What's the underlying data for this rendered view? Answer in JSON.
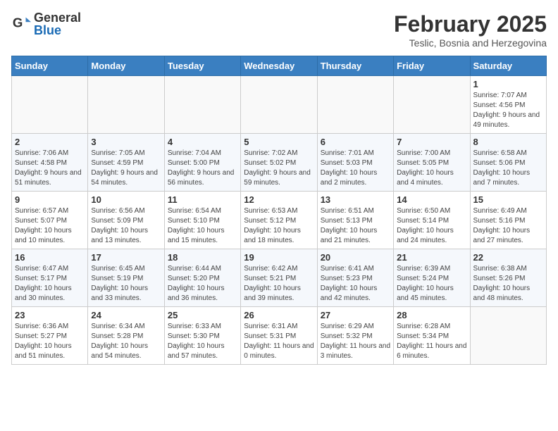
{
  "header": {
    "logo_general": "General",
    "logo_blue": "Blue",
    "month_year": "February 2025",
    "location": "Teslic, Bosnia and Herzegovina"
  },
  "weekdays": [
    "Sunday",
    "Monday",
    "Tuesday",
    "Wednesday",
    "Thursday",
    "Friday",
    "Saturday"
  ],
  "weeks": [
    [
      {
        "day": "",
        "info": ""
      },
      {
        "day": "",
        "info": ""
      },
      {
        "day": "",
        "info": ""
      },
      {
        "day": "",
        "info": ""
      },
      {
        "day": "",
        "info": ""
      },
      {
        "day": "",
        "info": ""
      },
      {
        "day": "1",
        "info": "Sunrise: 7:07 AM\nSunset: 4:56 PM\nDaylight: 9 hours and 49 minutes."
      }
    ],
    [
      {
        "day": "2",
        "info": "Sunrise: 7:06 AM\nSunset: 4:58 PM\nDaylight: 9 hours and 51 minutes."
      },
      {
        "day": "3",
        "info": "Sunrise: 7:05 AM\nSunset: 4:59 PM\nDaylight: 9 hours and 54 minutes."
      },
      {
        "day": "4",
        "info": "Sunrise: 7:04 AM\nSunset: 5:00 PM\nDaylight: 9 hours and 56 minutes."
      },
      {
        "day": "5",
        "info": "Sunrise: 7:02 AM\nSunset: 5:02 PM\nDaylight: 9 hours and 59 minutes."
      },
      {
        "day": "6",
        "info": "Sunrise: 7:01 AM\nSunset: 5:03 PM\nDaylight: 10 hours and 2 minutes."
      },
      {
        "day": "7",
        "info": "Sunrise: 7:00 AM\nSunset: 5:05 PM\nDaylight: 10 hours and 4 minutes."
      },
      {
        "day": "8",
        "info": "Sunrise: 6:58 AM\nSunset: 5:06 PM\nDaylight: 10 hours and 7 minutes."
      }
    ],
    [
      {
        "day": "9",
        "info": "Sunrise: 6:57 AM\nSunset: 5:07 PM\nDaylight: 10 hours and 10 minutes."
      },
      {
        "day": "10",
        "info": "Sunrise: 6:56 AM\nSunset: 5:09 PM\nDaylight: 10 hours and 13 minutes."
      },
      {
        "day": "11",
        "info": "Sunrise: 6:54 AM\nSunset: 5:10 PM\nDaylight: 10 hours and 15 minutes."
      },
      {
        "day": "12",
        "info": "Sunrise: 6:53 AM\nSunset: 5:12 PM\nDaylight: 10 hours and 18 minutes."
      },
      {
        "day": "13",
        "info": "Sunrise: 6:51 AM\nSunset: 5:13 PM\nDaylight: 10 hours and 21 minutes."
      },
      {
        "day": "14",
        "info": "Sunrise: 6:50 AM\nSunset: 5:14 PM\nDaylight: 10 hours and 24 minutes."
      },
      {
        "day": "15",
        "info": "Sunrise: 6:49 AM\nSunset: 5:16 PM\nDaylight: 10 hours and 27 minutes."
      }
    ],
    [
      {
        "day": "16",
        "info": "Sunrise: 6:47 AM\nSunset: 5:17 PM\nDaylight: 10 hours and 30 minutes."
      },
      {
        "day": "17",
        "info": "Sunrise: 6:45 AM\nSunset: 5:19 PM\nDaylight: 10 hours and 33 minutes."
      },
      {
        "day": "18",
        "info": "Sunrise: 6:44 AM\nSunset: 5:20 PM\nDaylight: 10 hours and 36 minutes."
      },
      {
        "day": "19",
        "info": "Sunrise: 6:42 AM\nSunset: 5:21 PM\nDaylight: 10 hours and 39 minutes."
      },
      {
        "day": "20",
        "info": "Sunrise: 6:41 AM\nSunset: 5:23 PM\nDaylight: 10 hours and 42 minutes."
      },
      {
        "day": "21",
        "info": "Sunrise: 6:39 AM\nSunset: 5:24 PM\nDaylight: 10 hours and 45 minutes."
      },
      {
        "day": "22",
        "info": "Sunrise: 6:38 AM\nSunset: 5:26 PM\nDaylight: 10 hours and 48 minutes."
      }
    ],
    [
      {
        "day": "23",
        "info": "Sunrise: 6:36 AM\nSunset: 5:27 PM\nDaylight: 10 hours and 51 minutes."
      },
      {
        "day": "24",
        "info": "Sunrise: 6:34 AM\nSunset: 5:28 PM\nDaylight: 10 hours and 54 minutes."
      },
      {
        "day": "25",
        "info": "Sunrise: 6:33 AM\nSunset: 5:30 PM\nDaylight: 10 hours and 57 minutes."
      },
      {
        "day": "26",
        "info": "Sunrise: 6:31 AM\nSunset: 5:31 PM\nDaylight: 11 hours and 0 minutes."
      },
      {
        "day": "27",
        "info": "Sunrise: 6:29 AM\nSunset: 5:32 PM\nDaylight: 11 hours and 3 minutes."
      },
      {
        "day": "28",
        "info": "Sunrise: 6:28 AM\nSunset: 5:34 PM\nDaylight: 11 hours and 6 minutes."
      },
      {
        "day": "",
        "info": ""
      }
    ]
  ]
}
